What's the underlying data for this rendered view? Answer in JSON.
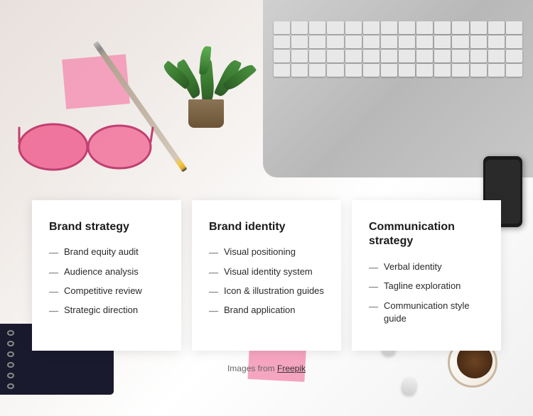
{
  "background": {
    "color": "#f5f5f5"
  },
  "cards": [
    {
      "id": "brand-strategy",
      "title": "Brand strategy",
      "items": [
        "Brand equity audit",
        "Audience analysis",
        "Competitive review",
        "Strategic direction"
      ]
    },
    {
      "id": "brand-identity",
      "title": "Brand identity",
      "items": [
        "Visual positioning",
        "Visual identity system",
        "Icon & illustration guides",
        "Brand application"
      ]
    },
    {
      "id": "communication-strategy",
      "title": "Communication strategy",
      "items": [
        "Verbal identity",
        "Tagline exploration",
        "Communication style guide"
      ]
    }
  ],
  "footer": {
    "text_before_link": "Images from ",
    "link_text": "Freepik",
    "link_url": "#"
  },
  "dashes": "—"
}
